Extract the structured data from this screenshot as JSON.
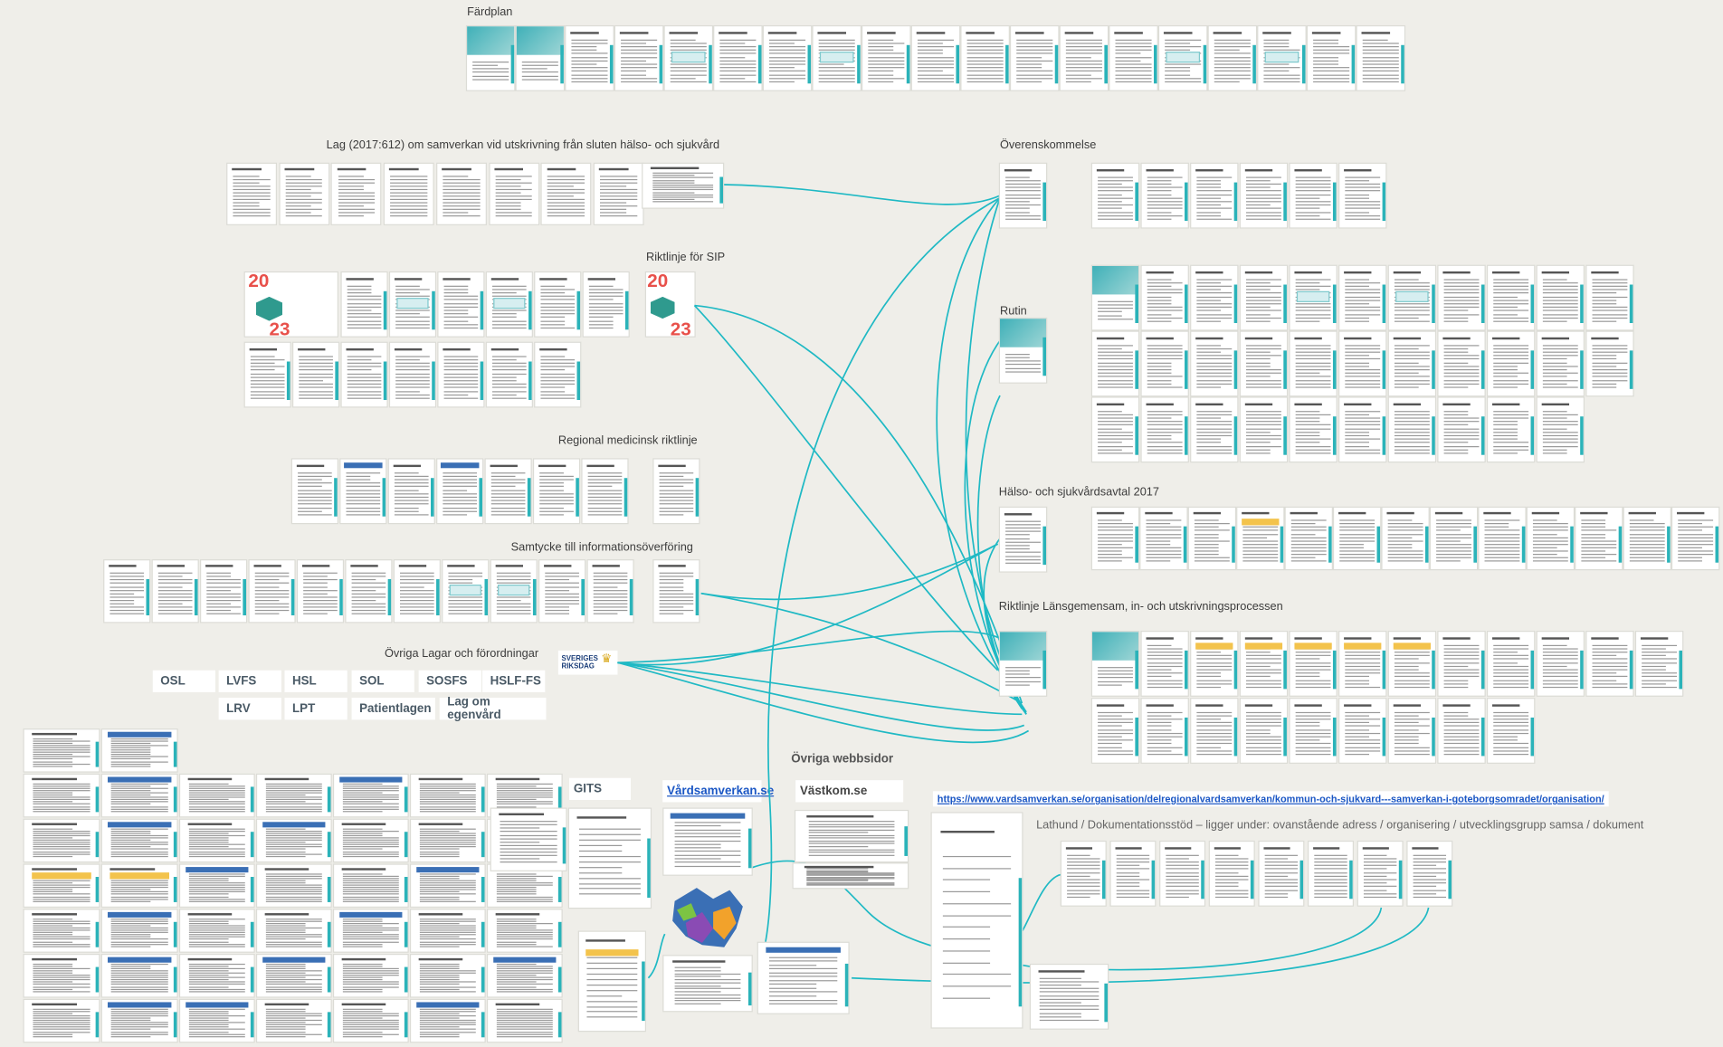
{
  "sections": {
    "fardplan": "Färdplan",
    "lag": "Lag (2017:612) om samverkan vid utskrivning från sluten hälso- och sjukvård",
    "riktlinje_sip": "Riktlinje för SIP",
    "regional": "Regional medicinsk riktlinje",
    "samtycke": "Samtycke till informationsöverföring",
    "ovriga_lagar": "Övriga Lagar och förordningar",
    "overenskommelse": "Överenskommelse",
    "rutin": "Rutin",
    "halso_avtal": "Hälso- och sjukvårdsavtal 2017",
    "riktlinje_lans": "Riktlinje Länsgemensam, in- och utskrivningsprocessen",
    "ovriga_webbsidor": "Övriga webbsidor",
    "lathund": "Lathund / Dokumentationsstöd – ligger under: ovanstående adress / organisering / utvecklingsgrupp samsa / dokument"
  },
  "year_badge": {
    "top": "20",
    "bottom": "23"
  },
  "law_tags": [
    "OSL",
    "LVFS",
    "HSL",
    "SOL",
    "SOSFS",
    "HSLF-FS",
    "LRV",
    "LPT",
    "Patientlagen",
    "Lag om egenvård"
  ],
  "riksdag": {
    "line1": "SVERIGES",
    "line2": "RIKSDAG"
  },
  "websites": {
    "gits": "GITS",
    "vardsamverkan": "Vårdsamverkan.se",
    "vastkom": "Västkom.se",
    "url": "https://www.vardsamverkan.se/organisation/delregionalvardsamverkan/kommun-och-sjukvard---samverkan-i-goteborgsomradet/organisation/"
  },
  "colors": {
    "connector": "#1fb9c4",
    "teal": "#3fb0b8",
    "background": "#efeee9",
    "link": "#1a56c4",
    "year_red": "#e8504a",
    "year_orange": "#f39a2b"
  }
}
